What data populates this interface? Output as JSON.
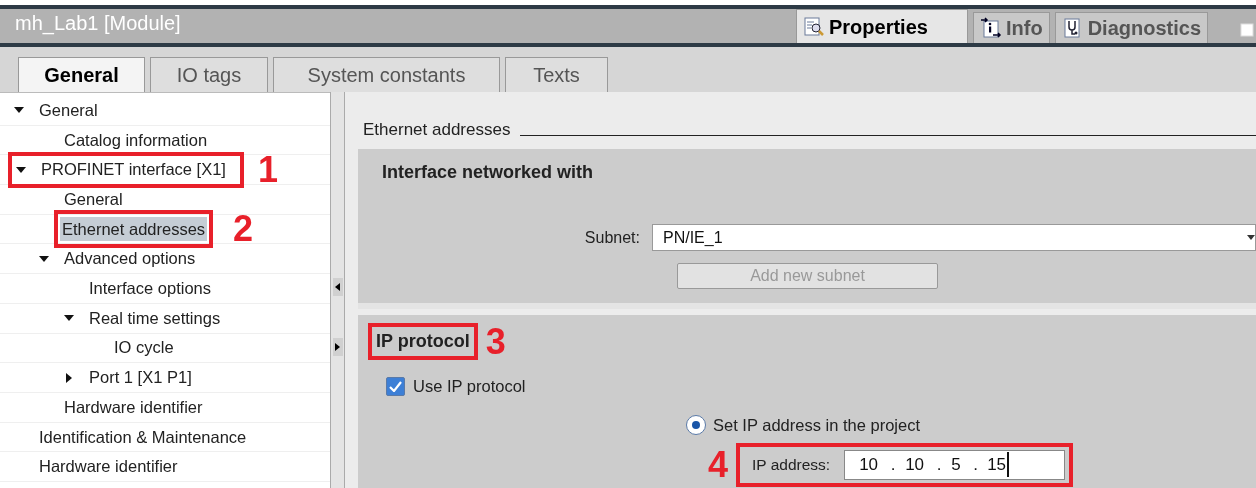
{
  "title_bar": {
    "title": "mh_Lab1 [Module]"
  },
  "inspector_tabs": [
    {
      "label": "Properties",
      "kind": "properties",
      "selected": true
    },
    {
      "label": "Info",
      "kind": "info",
      "selected": false
    },
    {
      "label": "Diagnostics",
      "kind": "diagnostics",
      "selected": false
    }
  ],
  "tabs": [
    {
      "label": "General",
      "selected": true
    },
    {
      "label": "IO tags",
      "selected": false
    },
    {
      "label": "System constants",
      "selected": false
    },
    {
      "label": "Texts",
      "selected": false
    }
  ],
  "tree": [
    {
      "label": "General",
      "expanded": true,
      "selected": false,
      "children": [
        {
          "label": "Catalog information",
          "selected": false
        }
      ]
    },
    {
      "label": "PROFINET interface [X1]",
      "expanded": true,
      "selected": false,
      "callout": "1",
      "children": [
        {
          "label": "General",
          "selected": false
        },
        {
          "label": "Ethernet addresses",
          "selected": true,
          "callout": "2"
        },
        {
          "label": "Advanced options",
          "expanded": true,
          "selected": false,
          "children": [
            {
              "label": "Interface options",
              "selected": false
            },
            {
              "label": "Real time settings",
              "expanded": true,
              "selected": false,
              "children": [
                {
                  "label": "IO cycle",
                  "selected": false
                }
              ]
            },
            {
              "label": "Port 1 [X1 P1]",
              "expanded": false,
              "selected": false
            }
          ]
        },
        {
          "label": "Hardware identifier",
          "selected": false
        }
      ]
    },
    {
      "label": "Identification & Maintenance",
      "selected": false
    },
    {
      "label": "Hardware identifier",
      "selected": false
    }
  ],
  "content": {
    "heading": "Ethernet addresses",
    "networked": {
      "title": "Interface networked with",
      "subnet_label": "Subnet:",
      "subnet_value": "PN/IE_1",
      "add_button": {
        "label": "Add new subnet",
        "disabled": true
      }
    },
    "ip": {
      "title": "IP protocol",
      "callout": "3",
      "use_ip": {
        "label": "Use IP protocol",
        "checked": true
      },
      "set_ip": {
        "label": "Set IP address in the project",
        "selected": true
      },
      "ip_address": {
        "label": "IP address:",
        "octets": [
          "10",
          "10",
          "5",
          "15"
        ],
        "separator": ".",
        "callout": "4"
      }
    }
  }
}
